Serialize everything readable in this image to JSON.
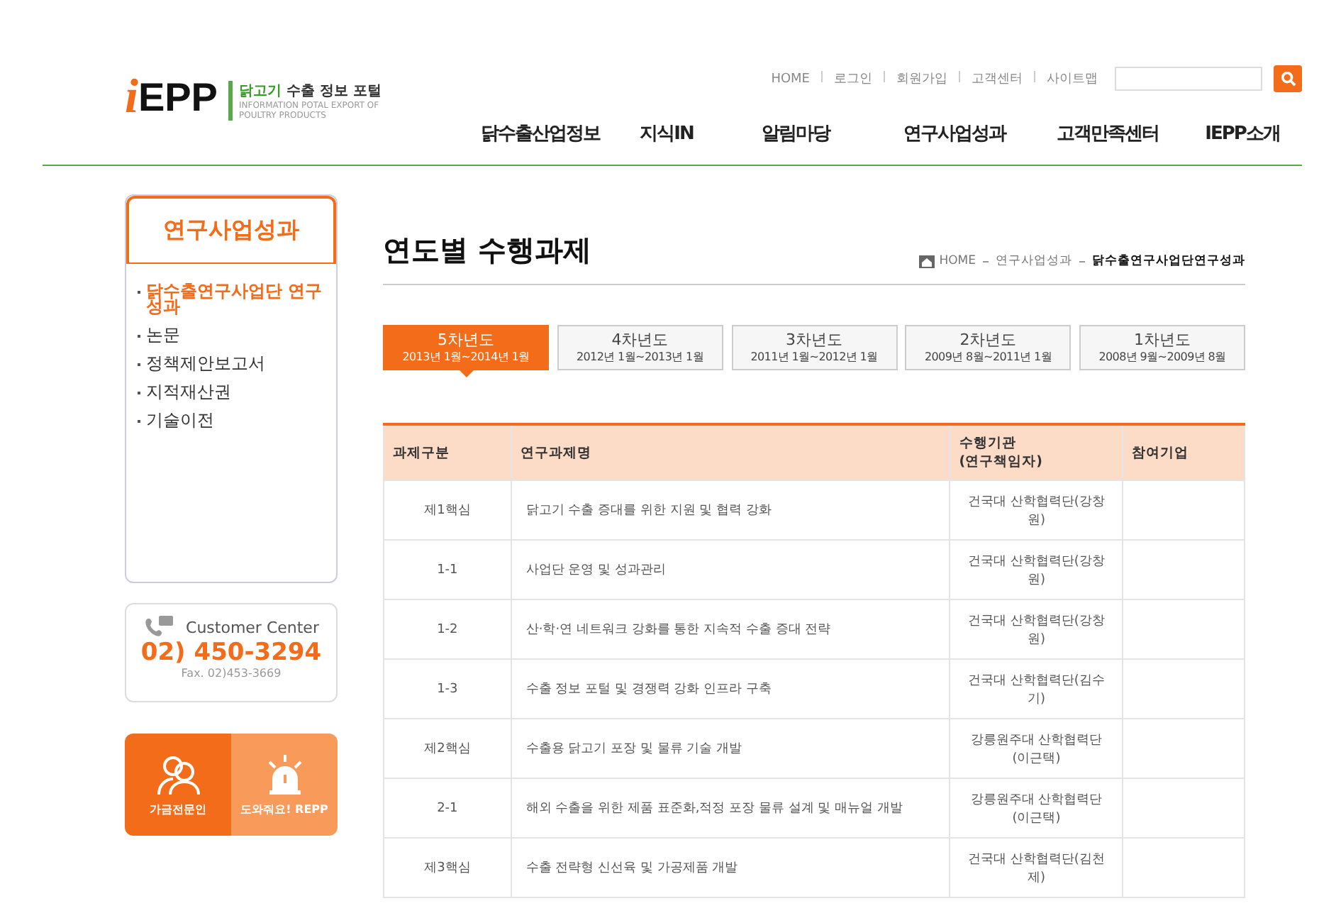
{
  "logo": {
    "mark": "i",
    "name": "EPP",
    "tagline_strong": "닭고기",
    "tagline": "수출 정보 포털",
    "subtitle": "INFORMATION POTAL EXPORT OF POULTRY PRODUCTS"
  },
  "util_links": [
    "HOME",
    "로그인",
    "회원가입",
    "고객센터",
    "사이트맵"
  ],
  "nav": [
    {
      "label": "닭수출산업정보",
      "selected": false
    },
    {
      "label": "지식IN",
      "selected": false
    },
    {
      "label": "알림마당",
      "selected": false
    },
    {
      "label": "연구사업성과",
      "selected": false
    },
    {
      "label": "고객만족센터",
      "selected": false
    },
    {
      "label": "IEPP소개",
      "selected": false
    }
  ],
  "sidebar": {
    "title": "연구사업성과",
    "items": [
      {
        "label": "닭수출연구사업단 연구성과",
        "selected": true
      },
      {
        "label": "논문",
        "selected": false
      },
      {
        "label": "정책제안보고서",
        "selected": false
      },
      {
        "label": "지적재산권",
        "selected": false
      },
      {
        "label": "기술이전",
        "selected": false
      }
    ]
  },
  "customer_center": {
    "title": "Customer Center",
    "phone": "02) 450-3294",
    "fax": "Fax. 02)453-3669"
  },
  "quick_links": [
    {
      "label": "가금전문인",
      "kind": "people"
    },
    {
      "label": "도와줘요! REPP",
      "kind": "siren"
    }
  ],
  "page_title": "연도별 수행과제",
  "breadcrumb": [
    "HOME",
    "연구사업성과",
    "닭수출연구사업단연구성과"
  ],
  "year_tabs": [
    {
      "label": "5차년도",
      "period": "2013년 1월~2014년 1월",
      "selected": true
    },
    {
      "label": "4차년도",
      "period": "2012년 1월~2013년 1월",
      "selected": false
    },
    {
      "label": "3차년도",
      "period": "2011년 1월~2012년 1월",
      "selected": false
    },
    {
      "label": "2차년도",
      "period": "2009년 8월~2011년 1월",
      "selected": false
    },
    {
      "label": "1차년도",
      "period": "2008년 9월~2009년 8월",
      "selected": false
    }
  ],
  "table": {
    "columns": [
      "과제구분",
      "연구과제명",
      "수행기관\n(연구책임자)",
      "참여기업"
    ],
    "rows": [
      [
        "제1핵심",
        "닭고기 수출 증대를 위한 지원 및 협력 강화",
        "건국대 산학협력단(강창원)"
      ],
      [
        "1-1",
        "사업단 운영 및 성과관리",
        "건국대 산학협력단(강창원)"
      ],
      [
        "1-2",
        "산·학·연 네트워크 강화를 통한 지속적 수출 증대 전략",
        "건국대 산학협력단(강창원)"
      ],
      [
        "1-3",
        "수출 정보 포털 및 경쟁력 강화 인프라 구축",
        "건국대 산학협력단(김수기)"
      ],
      [
        "제2핵심",
        "수출용 닭고기 포장 및 물류 기술 개발",
        "강릉원주대 산학협력단(이근택)"
      ],
      [
        "2-1",
        "해외 수출을 위한 제품 표준화,적정 포장 물류 설계 및 매뉴얼 개발",
        "강릉원주대 산학협력단(이근택)"
      ],
      [
        "제3핵심",
        "수출 전략형 신선육 및 가공제품 개발",
        "건국대 산학협력단(김천제)"
      ]
    ]
  }
}
